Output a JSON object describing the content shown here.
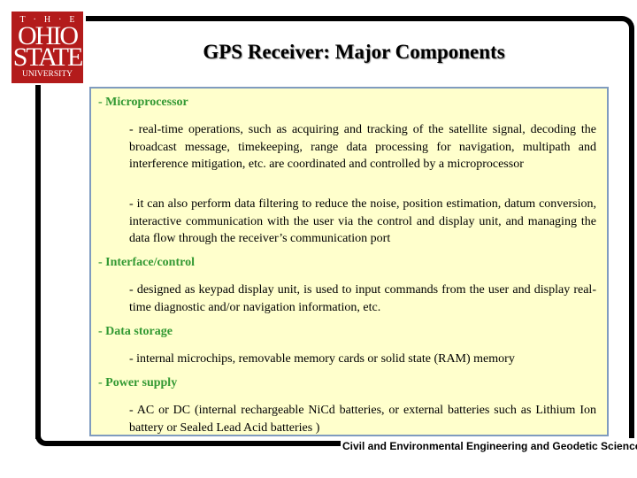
{
  "logo": {
    "the": "T·H·E",
    "line1": "OHIO",
    "line2": "STATE",
    "line3": "UNIVERSITY",
    "color": "#b31b1b"
  },
  "title": "GPS Receiver: Major Components",
  "sections": [
    {
      "heading": "- Microprocessor",
      "paragraphs": [
        "- real-time operations, such as acquiring and tracking of the satellite signal, decoding the broadcast message, timekeeping, range data processing for navigation, multipath and interference mitigation, etc. are coordinated and controlled by a microprocessor",
        "- it can also perform data filtering to reduce the noise, position estimation, datum conversion, interactive communication with the user via the control and display unit, and managing the data flow through the receiver’s communication port"
      ]
    },
    {
      "heading": "- Interface/control",
      "paragraphs": [
        "- designed as keypad display unit, is used to input commands from the user and display real-time diagnostic and/or navigation information, etc."
      ]
    },
    {
      "heading": "- Data storage",
      "paragraphs": [
        "- internal microchips, removable memory cards or solid state (RAM) memory"
      ]
    },
    {
      "heading": "- Power supply",
      "paragraphs": [
        "- AC or DC (internal rechargeable NiCd batteries, or external batteries such as Lithium Ion battery or Sealed Lead Acid batteries )"
      ]
    }
  ],
  "footer": "Civil and Environmental Engineering and Geodetic Science",
  "colors": {
    "heading": "#339933",
    "panel_bg": "#ffffcc",
    "panel_border": "#7f9bbf"
  }
}
